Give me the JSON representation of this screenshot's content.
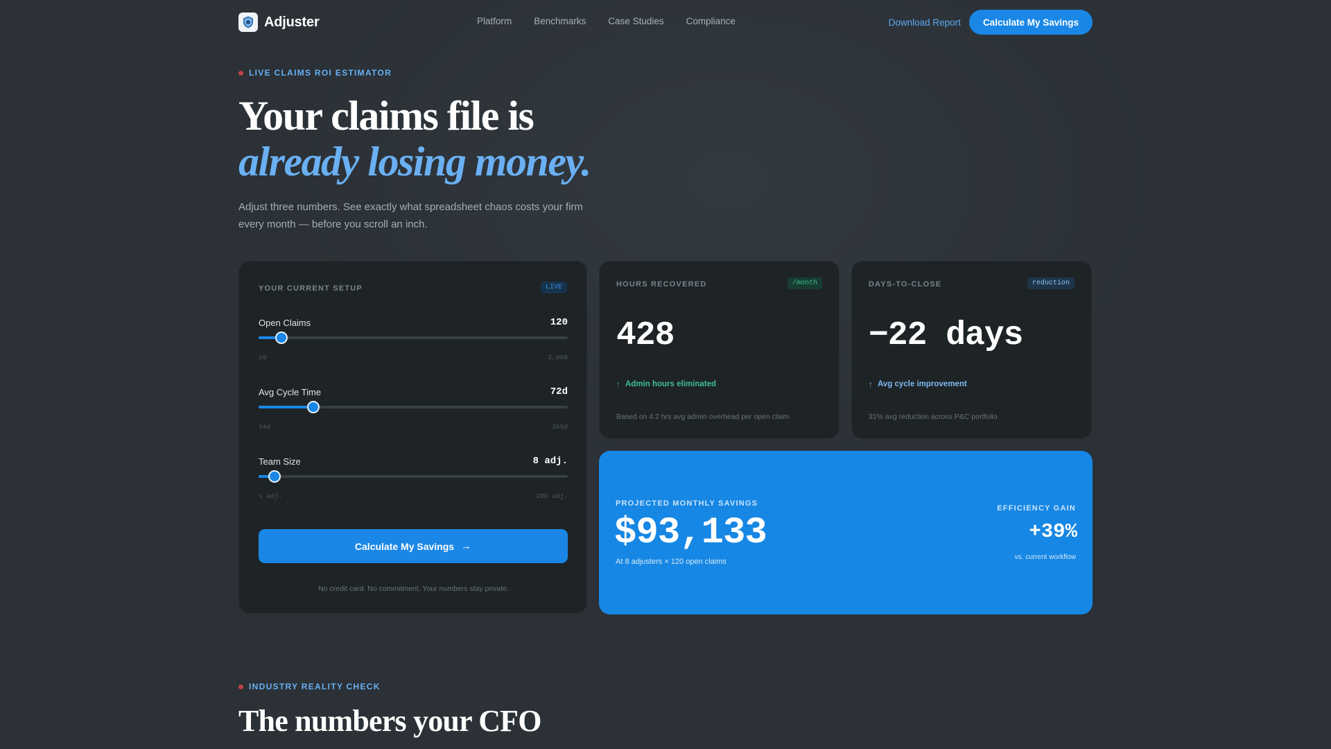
{
  "nav": {
    "brand": "Adjuster",
    "links": [
      "Platform",
      "Benchmarks",
      "Case Studies",
      "Compliance"
    ],
    "download": "Download Report",
    "cta": "Calculate My Savings"
  },
  "hero": {
    "eyebrow": "LIVE CLAIMS ROI ESTIMATOR",
    "title_line1": "Your claims file is",
    "title_line2": "already losing money.",
    "subtitle": "Adjust three numbers. See exactly what spreadsheet chaos costs your firm every month — before you scroll an inch."
  },
  "setup": {
    "label": "YOUR CURRENT SETUP",
    "tag": "LIVE",
    "sliders": [
      {
        "label": "Open Claims",
        "value": "120",
        "min": "10",
        "max": "2,000",
        "fraction": 0.074
      },
      {
        "label": "Avg Cycle Time",
        "value": "72d",
        "min": "14d",
        "max": "365d",
        "fraction": 0.178
      },
      {
        "label": "Team Size",
        "value": "8 adj.",
        "min": "1 adj.",
        "max": "200 adj.",
        "fraction": 0.052
      }
    ],
    "cta": "Calculate My Savings",
    "note": "No credit card. No commitment. Your numbers stay private."
  },
  "hours": {
    "label": "HOURS RECOVERED",
    "tag": "/month",
    "value": "428",
    "trend": "Admin hours eliminated",
    "foot": "Based on 4.2 hrs avg admin overhead per open claim"
  },
  "days": {
    "label": "DAYS-TO-CLOSE",
    "tag": "reduction",
    "value": "−22 days",
    "trend": "Avg cycle improvement",
    "foot": "31% avg reduction across P&C portfolio"
  },
  "savings": {
    "label": "PROJECTED MONTHLY SAVINGS",
    "value": "$93,133",
    "note": "At 8 adjusters × 120 open claims",
    "gain_label": "EFFICIENCY GAIN",
    "gain_value": "+39%",
    "gain_note": "vs. current workflow"
  },
  "reality": {
    "eyebrow": "INDUSTRY REALITY CHECK",
    "title": "The numbers your CFO"
  },
  "colors": {
    "accent": "#1a87e6",
    "accent_light": "#6ab0f3",
    "positive": "#3fbf8f",
    "background": "#2b3136",
    "card": "#1e2326"
  }
}
